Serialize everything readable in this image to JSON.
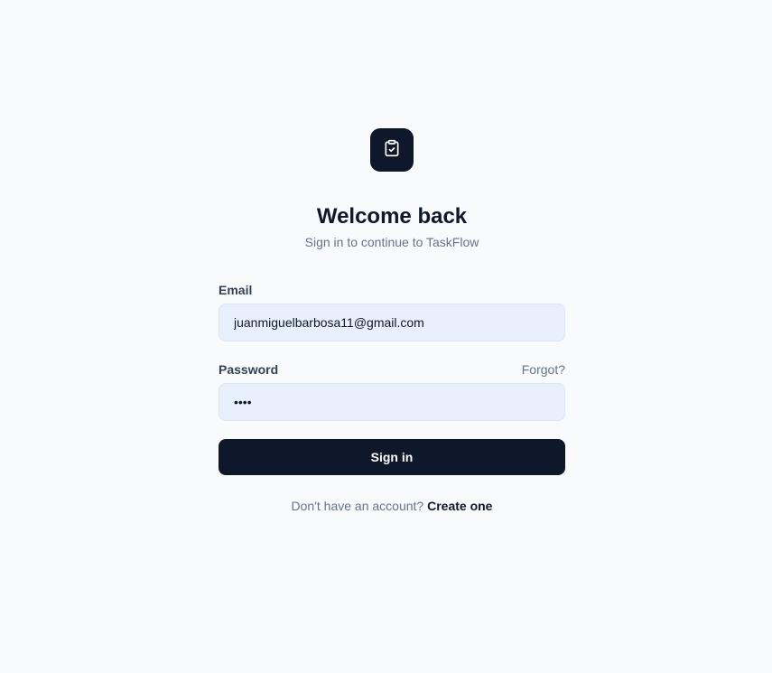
{
  "app": {
    "logo_icon": "clipboard-check-icon",
    "title": "Welcome back",
    "subtitle": "Sign in to continue to TaskFlow"
  },
  "form": {
    "email_label": "Email",
    "email_value": "juanmiguelbarbosa11@gmail.com",
    "password_label": "Password",
    "password_value": "abcd",
    "forgot_label": "Forgot?",
    "submit_label": "Sign in"
  },
  "footer": {
    "prompt": "Don't have an account?",
    "link": "Create one"
  },
  "colors": {
    "background": "#f8fafc",
    "primary": "#0f172a",
    "muted": "#64748b",
    "input_fill": "#e8f0fe"
  }
}
